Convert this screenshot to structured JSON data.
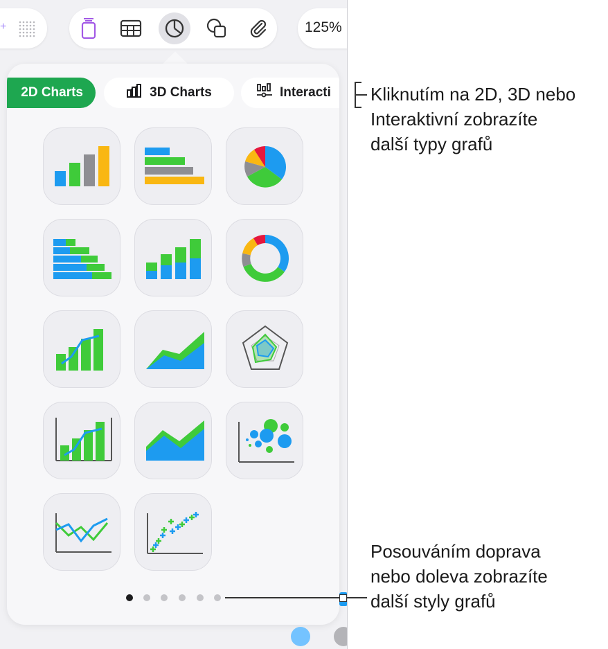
{
  "toolbar": {
    "zoom": "125%",
    "tools": [
      "insert-icon",
      "table-icon",
      "chart-icon",
      "shape-icon",
      "paperclip-icon"
    ]
  },
  "chart_popover": {
    "tabs": [
      {
        "label": "2D Charts",
        "selected": true
      },
      {
        "label": "3D Charts",
        "icon": "3d-bars-icon"
      },
      {
        "label": "Interacti",
        "icon": "interactive-chart-icon"
      }
    ],
    "chart_types": [
      "column",
      "bar",
      "pie",
      "stacked-bar",
      "stacked-column",
      "donut",
      "mixed-column-line",
      "area",
      "radar",
      "2-axis",
      "stacked-area",
      "bubble",
      "line",
      "scatter"
    ],
    "page_count": 6,
    "current_page": 1
  },
  "colors": {
    "green": "#3fcb3a",
    "blue": "#1d9bf0",
    "gray": "#8e8e93",
    "yellow": "#f9b712",
    "red": "#e5173d",
    "tab_selected": "#1ea750"
  },
  "annotations": {
    "tabs_callout": "Kliknutím na 2D, 3D nebo\nInteraktivní zobrazíte\ndalší typy grafů",
    "dots_callout": "Posouváním doprava\nnebo doleva zobrazíte\ndalší styly grafů"
  }
}
